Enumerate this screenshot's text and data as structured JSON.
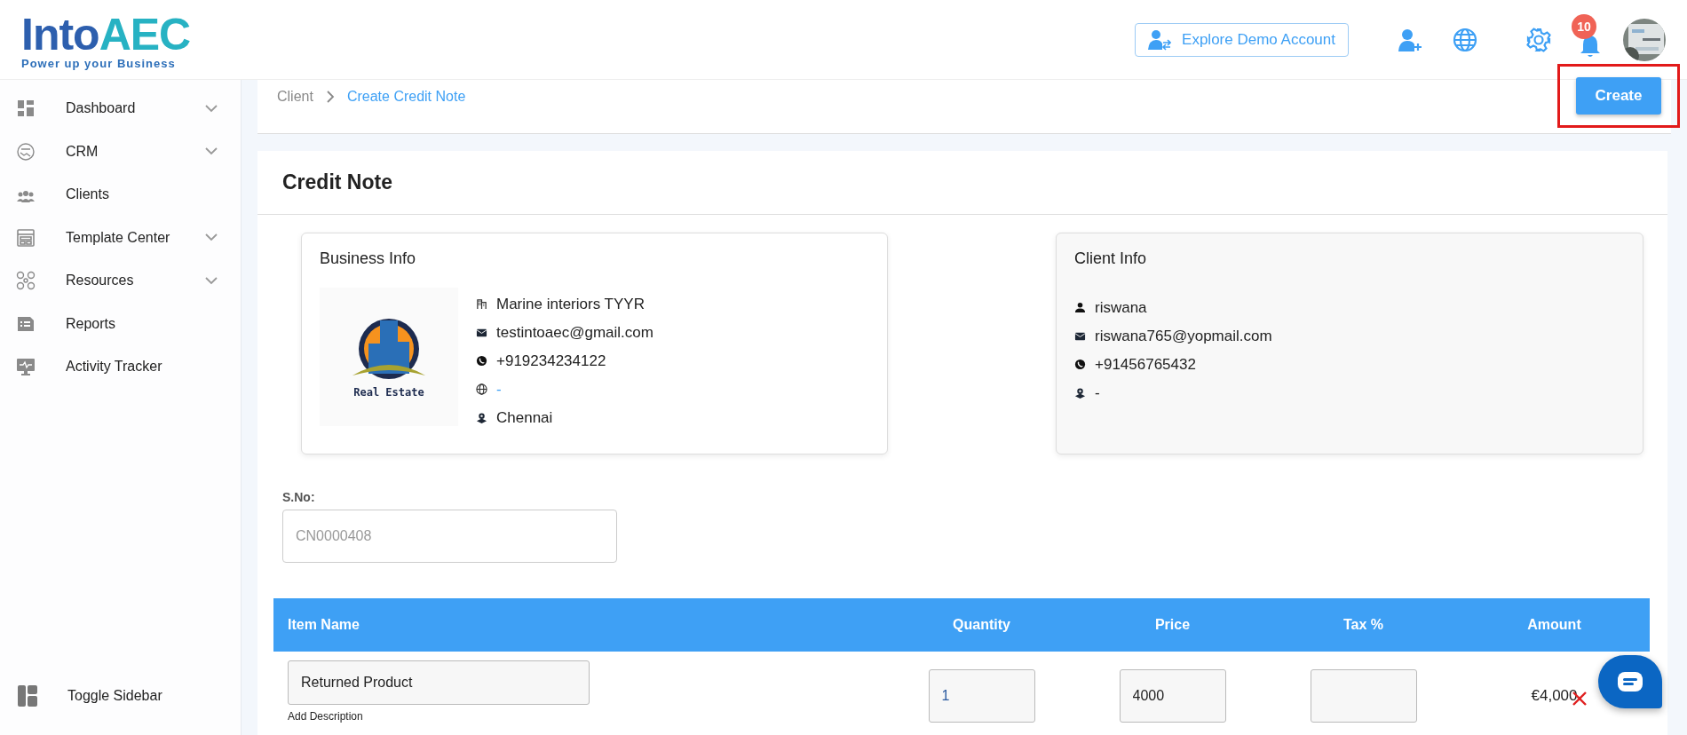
{
  "logo": {
    "name_left": "Into",
    "name_right": "AEC",
    "tagline": "Power up your Business"
  },
  "header": {
    "demo_button": "Explore Demo Account",
    "notifications": "10"
  },
  "sidebar": {
    "items": [
      {
        "label": "Dashboard",
        "has_submenu": true
      },
      {
        "label": "CRM",
        "has_submenu": true
      },
      {
        "label": "Clients",
        "has_submenu": false
      },
      {
        "label": "Template Center",
        "has_submenu": true
      },
      {
        "label": "Resources",
        "has_submenu": true
      },
      {
        "label": "Reports",
        "has_submenu": false
      },
      {
        "label": "Activity Tracker",
        "has_submenu": false
      }
    ],
    "toggle": "Toggle Sidebar"
  },
  "breadcrumb": [
    {
      "label": "Client",
      "selected": false
    },
    {
      "label": "Create Credit Note",
      "selected": true
    }
  ],
  "create_button": {
    "label": "Create",
    "highlighted": true
  },
  "page_title": "Credit Note",
  "business_info": {
    "title": "Business Info",
    "logo_text": "Real Estate",
    "name": "Marine interiors TYYR",
    "email": "testintoaec@gmail.com",
    "phone": "+919234234122",
    "website": "-",
    "city": "Chennai"
  },
  "client_info": {
    "title": "Client Info",
    "name": "riswana",
    "email": "riswana765@yopmail.com",
    "phone": "+91456765432",
    "address": "-"
  },
  "serial": {
    "label": "S.No:",
    "placeholder": "CN0000408"
  },
  "table": {
    "columns": [
      "Item Name",
      "Quantity",
      "Price",
      "Tax %",
      "Amount"
    ],
    "rows": [
      {
        "item": "Returned Product",
        "description_link": "Add Description",
        "quantity": "1",
        "price": "4000",
        "tax": "",
        "amount": "€4,000"
      }
    ]
  }
}
